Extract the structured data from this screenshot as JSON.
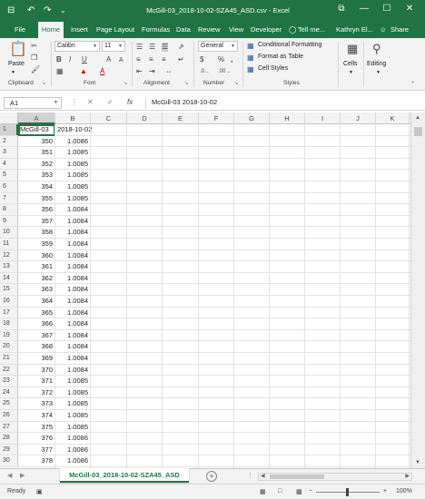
{
  "titlebar": {
    "title": "McGill-03_2018-10-02-SZA45_ASD.csv - Excel",
    "save_icon": "⊟",
    "undo_icon": "↶",
    "redo_icon": "↷",
    "qat_more_icon": "⌄",
    "ribbon_display_icon": "⧉",
    "minimize_icon": "—",
    "maximize_icon": "☐",
    "close_icon": "✕"
  },
  "tabs": [
    "File",
    "Home",
    "Insert",
    "Page Layout",
    "Formulas",
    "Data",
    "Review",
    "View",
    "Developer"
  ],
  "active_tab": "Home",
  "tell_me": "Tell me...",
  "user": "Kathryn El...",
  "share": "Share",
  "ribbon": {
    "clipboard": {
      "label": "Clipboard",
      "paste": "Paste"
    },
    "font": {
      "label": "Font",
      "font_name": "Calibri",
      "font_size": "11",
      "bold": "B",
      "italic": "I",
      "underline": "U",
      "grow": "A",
      "shrink": "A"
    },
    "alignment": {
      "label": "Alignment"
    },
    "number": {
      "label": "Number",
      "format": "General",
      "currency": "$",
      "percent": "%",
      "comma": ","
    },
    "styles": {
      "label": "Styles",
      "conditional": "Conditional Formatting",
      "format_table": "Format as Table",
      "cell_styles": "Cell Styles"
    },
    "cells": {
      "label": "Cells"
    },
    "editing": {
      "label": "Editing"
    }
  },
  "formula_bar": {
    "name_box": "A1",
    "cancel_icon": "✕",
    "enter_icon": "✓",
    "fx": "fx",
    "value": "McGill-03 2018-10-02"
  },
  "columns": [
    "A",
    "B",
    "C",
    "D",
    "E",
    "F",
    "G",
    "H",
    "I",
    "J",
    "K"
  ],
  "row_numbers": [
    "1",
    "2",
    "3",
    "4",
    "5",
    "6",
    "7",
    "8",
    "9",
    "10",
    "11",
    "12",
    "13",
    "14",
    "15",
    "16",
    "17",
    "18",
    "19",
    "20",
    "21",
    "22",
    "23",
    "24",
    "25",
    "26",
    "27",
    "28",
    "29",
    "30"
  ],
  "cells": [
    [
      "McGill-03",
      "2018-10-02"
    ],
    [
      "350",
      "1.0086"
    ],
    [
      "351",
      "1.0085"
    ],
    [
      "352",
      "1.0085"
    ],
    [
      "353",
      "1.0085"
    ],
    [
      "354",
      "1.0085"
    ],
    [
      "355",
      "1.0085"
    ],
    [
      "356",
      "1.0084"
    ],
    [
      "357",
      "1.0084"
    ],
    [
      "358",
      "1.0084"
    ],
    [
      "359",
      "1.0084"
    ],
    [
      "360",
      "1.0084"
    ],
    [
      "361",
      "1.0084"
    ],
    [
      "362",
      "1.0084"
    ],
    [
      "363",
      "1.0084"
    ],
    [
      "364",
      "1.0084"
    ],
    [
      "365",
      "1.0084"
    ],
    [
      "366",
      "1.0084"
    ],
    [
      "367",
      "1.0084"
    ],
    [
      "368",
      "1.0084"
    ],
    [
      "369",
      "1.0084"
    ],
    [
      "370",
      "1.0084"
    ],
    [
      "371",
      "1.0085"
    ],
    [
      "372",
      "1.0085"
    ],
    [
      "373",
      "1.0085"
    ],
    [
      "374",
      "1.0085"
    ],
    [
      "375",
      "1.0085"
    ],
    [
      "376",
      "1.0086"
    ],
    [
      "377",
      "1.0086"
    ],
    [
      "378",
      "1.0086"
    ]
  ],
  "sheet_tab": "McGill-03_2018-10-02-SZA45_ASD",
  "add_sheet": "+",
  "status": {
    "ready": "Ready",
    "zoom": "100%",
    "zoom_minus": "−",
    "zoom_plus": "+"
  },
  "colors": {
    "accent": "#217346"
  }
}
